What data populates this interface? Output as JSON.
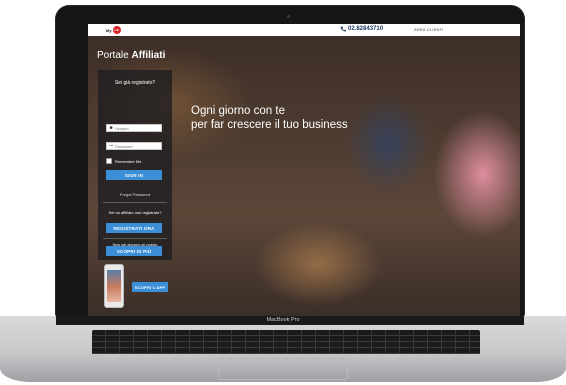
{
  "device": {
    "brand": "MacBook Pro"
  },
  "topbar": {
    "logo_text": "My",
    "logo_circle": "Lib",
    "phone_icon": "phone-icon",
    "phone": "02.82843710",
    "area_label": "AREA CLIENTI"
  },
  "portal": {
    "title_prefix": "Portale",
    "title_strong": "Affiliati"
  },
  "login": {
    "heading": "Sei già registrato?",
    "username_placeholder": "Usuario",
    "password_placeholder": "Password",
    "remember_label": "Remember Me",
    "signin_label": "SIGN IN",
    "forgot_label": "Forgot Password"
  },
  "register": {
    "heading": "Sei un affiliato non registrato?",
    "button_label": "REGISTRATI ORA"
  },
  "discover": {
    "heading": "Non sei ancora un nostro affiliato?",
    "button_label": "SCOPRI DI PIÙ"
  },
  "app": {
    "button_label": "SCOPRI L'APP"
  },
  "hero": {
    "line1": "Ogni giorno con te",
    "line2": "per far crescere il tuo business"
  },
  "colors": {
    "accent": "#3a8fd6",
    "brand_red": "#d8262b",
    "phone_text": "#1f3a63"
  }
}
